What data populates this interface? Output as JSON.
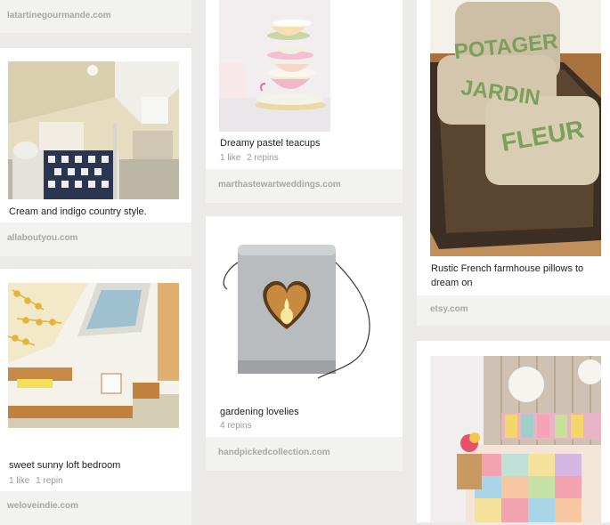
{
  "pins": [
    {
      "source": "latartinegourmande.com"
    },
    {
      "description": "Cream and indigo country style.",
      "source": "allaboutyou.com"
    },
    {
      "description": "sweet sunny loft bedroom",
      "likes": "1 like",
      "repins": "1 repin",
      "source": "weloveindie.com"
    },
    {
      "description": "Dreamy pastel teacups",
      "likes": "1 like",
      "repins": "2 repins",
      "source": "marthastewartweddings.com"
    },
    {
      "description": "gardening lovelies",
      "repins": "4 repins",
      "source": "handpickedcollection.com"
    },
    {
      "image_text": [
        "POTAGER",
        "JARDIN",
        "FLEUR"
      ],
      "description": "Rustic French farmhouse pillows to dream on",
      "source": "etsy.com"
    },
    {
      "description": ""
    }
  ],
  "colors": {
    "background": "#ebeae8",
    "source_bar": "#f2f2f0",
    "pillow_text": "#7aa05a"
  }
}
